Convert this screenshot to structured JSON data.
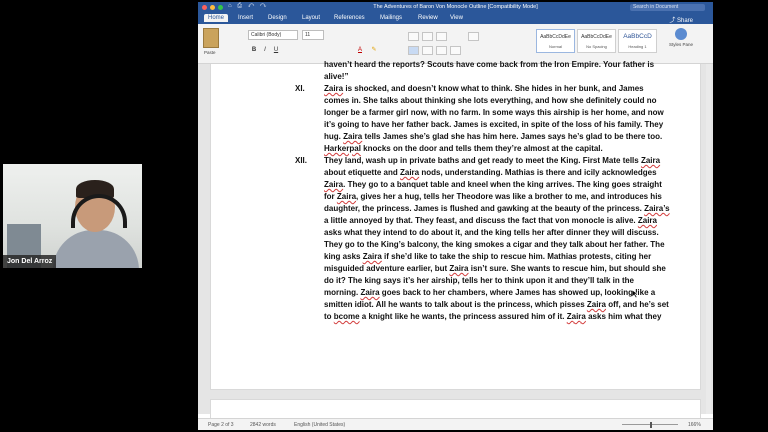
{
  "webcam": {
    "name": "Jon Del Arroz"
  },
  "window": {
    "title": "The Adventures of Baron Von Monocle Outline [Compatibility Mode]",
    "search_placeholder": "Search in Document",
    "tabs": [
      "Home",
      "Insert",
      "Design",
      "Layout",
      "References",
      "Mailings",
      "Review",
      "View"
    ],
    "share": "Share",
    "font": "Calibri (Body)",
    "font_size": "11",
    "paste_label": "Paste",
    "styles": [
      {
        "sample": "AaBbCcDdEe",
        "name": "Normal"
      },
      {
        "sample": "AaBbCcDdEe",
        "name": "No Spacing"
      },
      {
        "sample": "AaBbCcD",
        "name": "Heading 1"
      }
    ],
    "styles_pane": "Styles Pane"
  },
  "document": {
    "lines": [
      "haven’t heard the reports? Scouts have come back from the Iron Empire. Your father is",
      "alive!”",
      "Zaira is shocked, and doesn’t know what to think.  She hides in her bunk, and James",
      "comes in. She talks about thinking she lots everything, and how she definitely could no",
      "longer be a farmer girl now, with no farm.  In some ways this airship is her home, and now",
      "it’s going to have her father back.  James is excited, in spite of the loss of his family. They",
      "hug.  Zaira tells James she’s glad she has him here.  James says he’s glad to be there too.",
      "Harkerpal knocks on the door and tells them they’re almost at the capital.",
      "They land, wash up in private baths and get ready to meet the King. First Mate tells Zaira",
      "about etiquette and Zaira nods, understanding. Mathias is there and icily acknowledges",
      "Zaira. They go to a banquet table and kneel when the king arrives. The king goes straight",
      "for Zaira, gives her a hug, tells her Theodore was like a brother to me, and introduces his",
      "daughter, the princess. James is flushed and gawking at the beauty of the princess. Zaira’s",
      "a little annoyed by that.  They feast, and discuss the fact that von monocle is alive.  Zaira",
      "asks what they intend to do about it, and the king tells her after dinner they will discuss.",
      "They go to the King’s balcony, the king smokes a cigar and they talk about her father. The",
      "king asks Zaira if she’d like to take the ship to rescue him. Mathias protests, citing her",
      "misguided adventure earlier, but Zaira isn’t sure. She wants to rescue him, but should she",
      "do it?  The king says it’s her airship, tells her to think upon it and they’ll talk in the",
      "morning. Zaira goes back to her chambers, where James has showed up, looking like a",
      "smitten idiot. All he wants to talk about is the princess, which pisses Zaira off, and he’s set",
      "to bcome a knight like he wants, the princess assured him of it.  Zaira asks him what they"
    ],
    "numerals": [
      "XI.",
      "XII."
    ]
  },
  "status_bar": {
    "page": "Page 2 of 3",
    "words": "2842 words",
    "language": "English (United States)",
    "zoom": "166%"
  }
}
